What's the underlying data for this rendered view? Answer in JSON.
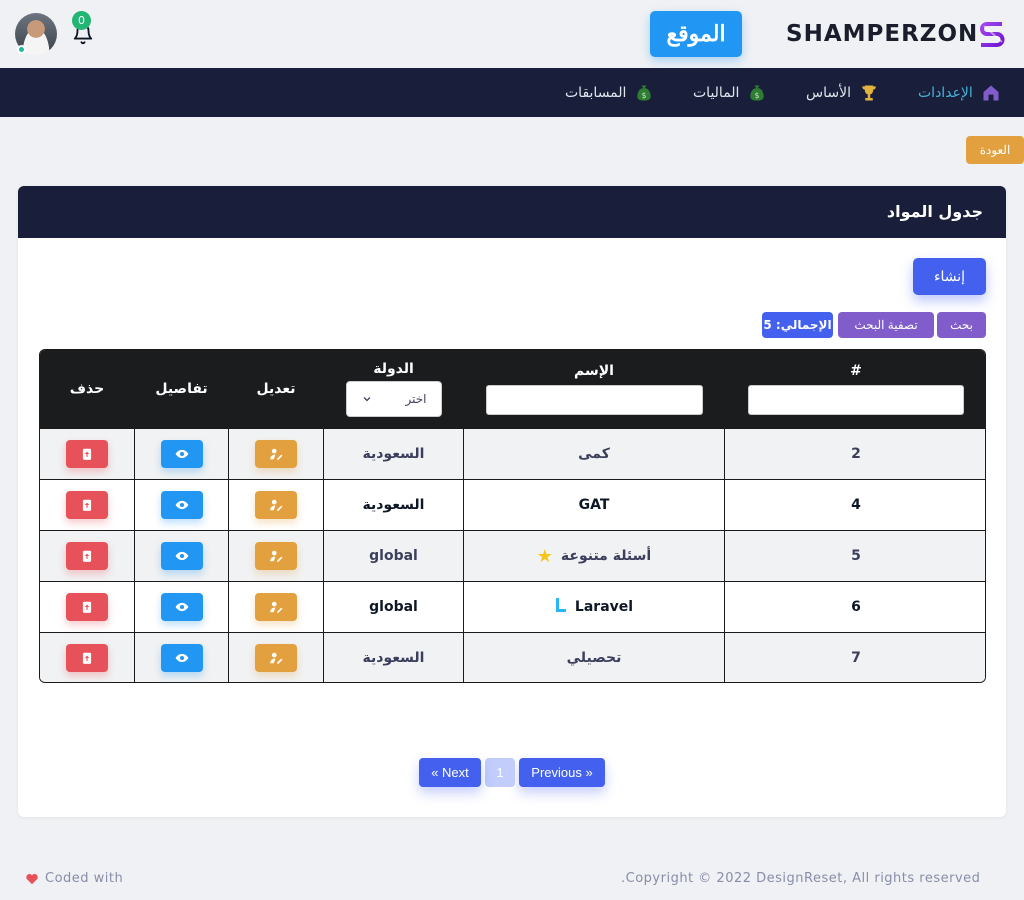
{
  "header": {
    "brand": "SHAMPERZON",
    "site_button": "الموقع",
    "notifications_count": "0"
  },
  "nav": [
    {
      "label": "الإعدادات",
      "icon": "home-icon",
      "active": true
    },
    {
      "label": "الأساس",
      "icon": "trophy-icon",
      "active": false
    },
    {
      "label": "الماليات",
      "icon": "money-bag-icon",
      "active": false
    },
    {
      "label": "المسابقات",
      "icon": "money-bag-icon",
      "active": false
    }
  ],
  "back_button": "العودة",
  "card": {
    "title": "جدول المواد",
    "create_button": "إنشاء",
    "search_chip": "بحث",
    "filter_chip": "تصفية البحث",
    "total_chip": "الإجمالي: 5"
  },
  "table": {
    "headers": {
      "id": "#",
      "name": "الإسم",
      "country": "الدولة",
      "edit": "تعديل",
      "details": "تفاصيل",
      "delete": "حذف"
    },
    "country_select": "اختر",
    "rows": [
      {
        "id": "2",
        "name": "كمى",
        "badge": "",
        "country": "السعودية"
      },
      {
        "id": "4",
        "name": "GAT",
        "badge": "",
        "country": "السعودية"
      },
      {
        "id": "5",
        "name": "أسئلة متنوعة",
        "badge": "star",
        "country": "global"
      },
      {
        "id": "6",
        "name": "Laravel",
        "badge": "laravel",
        "country": "global"
      },
      {
        "id": "7",
        "name": "تحصيلي",
        "badge": "",
        "country": "السعودية"
      }
    ]
  },
  "pagination": {
    "previous": "Previous »",
    "current": "1",
    "next": "« Next"
  },
  "footer": {
    "left": "Coded with",
    "right": ".Copyright © 2022 DesignReset, All rights reserved"
  },
  "colors": {
    "nav_bg": "#191e3a",
    "primary": "#4361ee",
    "info": "#2196f3",
    "warning": "#e2a03f",
    "danger": "#e7515a",
    "secondary": "#805dca"
  }
}
